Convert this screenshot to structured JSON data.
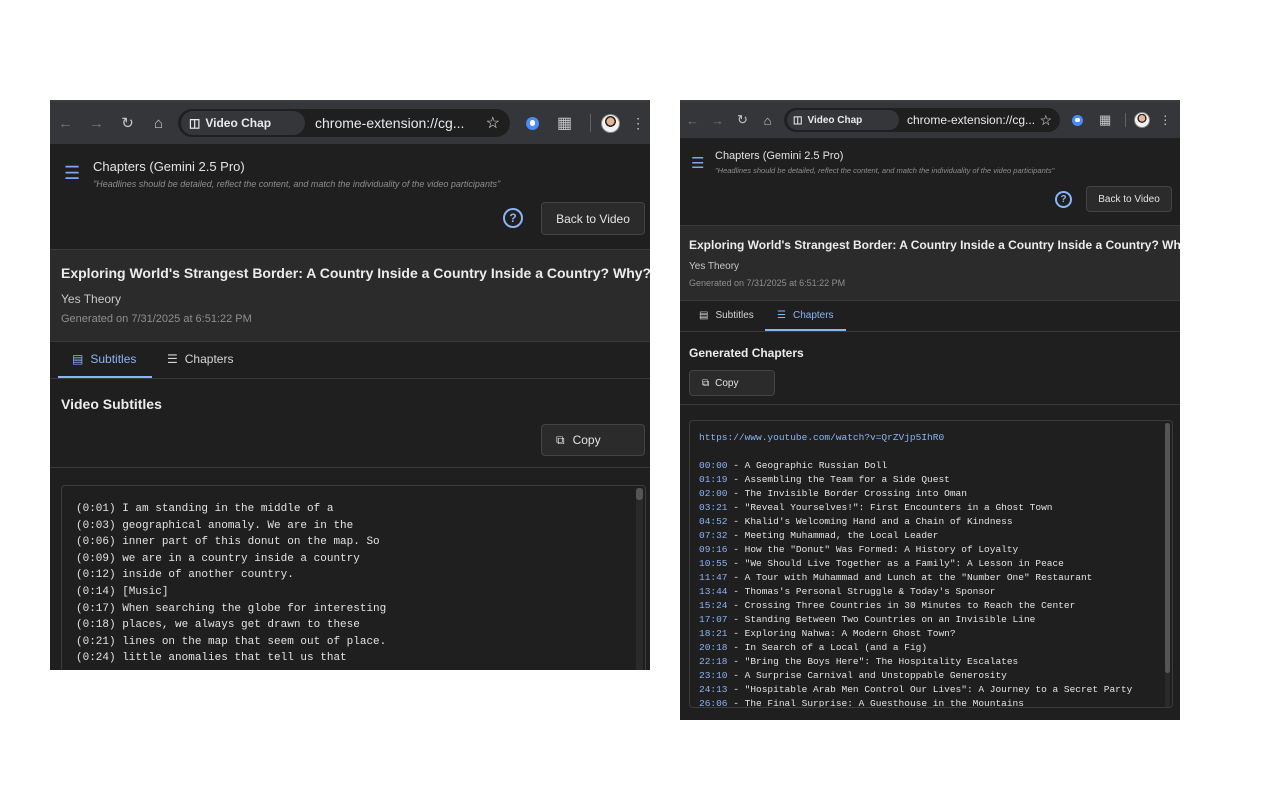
{
  "browser": {
    "site_chip": "Video Chap",
    "url": "chrome-extension://cg...",
    "icons": {
      "back": "arrow-left-icon",
      "forward": "arrow-right-icon",
      "reload": "reload-icon",
      "home": "home-icon",
      "site": "extension-page-icon",
      "star": "star-icon",
      "extension": "extension-active-icon",
      "extensions_menu": "puzzle-icon",
      "profile": "avatar",
      "menu": "kebab-menu-icon"
    }
  },
  "header": {
    "title": "Chapters (Gemini 2.5 Pro)",
    "quote": "\"Headlines should be detailed, reflect the content, and match the individuality of the video participants\"",
    "help": "?",
    "back_button": "Back to Video"
  },
  "video": {
    "title": "Exploring World's Strangest Border: A Country Inside a Country Inside a Country? Why?",
    "channel": "Yes Theory",
    "generated": "Generated on 7/31/2025 at 6:51:22 PM"
  },
  "tabs": [
    {
      "label": "Subtitles",
      "icon": "subtitles-icon"
    },
    {
      "label": "Chapters",
      "icon": "list-icon"
    }
  ],
  "subtitles_view": {
    "active_tab": "Subtitles",
    "section_title": "Video Subtitles",
    "copy_button": "Copy",
    "lines": [
      "(0:01) I am standing in the middle of a",
      "(0:03) geographical anomaly. We are in the",
      "(0:06) inner part of this donut on the map. So",
      "(0:09) we are in a country inside a country",
      "(0:12) inside of another country.",
      "(0:14) [Music]",
      "(0:17) When searching the globe for interesting",
      "(0:18) places, we always get drawn to these",
      "(0:21) lines on the map that seem out of place.",
      "(0:24) little anomalies that tell us that"
    ]
  },
  "chapters_view": {
    "active_tab": "Chapters",
    "section_title": "Generated Chapters",
    "copy_button": "Copy",
    "link": "https://www.youtube.com/watch?v=QrZVjp5IhR0",
    "chapters": [
      {
        "time": "00:00",
        "title": " - A Geographic Russian Doll"
      },
      {
        "time": "01:19",
        "title": " - Assembling the Team for a Side Quest"
      },
      {
        "time": "02:00",
        "title": " - The Invisible Border Crossing into Oman"
      },
      {
        "time": "03:21",
        "title": " - \"Reveal Yourselves!\": First Encounters in a Ghost Town"
      },
      {
        "time": "04:52",
        "title": " - Khalid's Welcoming Hand and a Chain of Kindness"
      },
      {
        "time": "07:32",
        "title": " - Meeting Muhammad, the Local Leader"
      },
      {
        "time": "09:16",
        "title": " - How the \"Donut\" Was Formed: A History of Loyalty"
      },
      {
        "time": "10:55",
        "title": " - \"We Should Live Together as a Family\": A Lesson in Peace"
      },
      {
        "time": "11:47",
        "title": " - A Tour with Muhammad and Lunch at the \"Number One\" Restaurant"
      },
      {
        "time": "13:44",
        "title": " - Thomas's Personal Struggle & Today's Sponsor"
      },
      {
        "time": "15:24",
        "title": " - Crossing Three Countries in 30 Minutes to Reach the Center"
      },
      {
        "time": "17:07",
        "title": " - Standing Between Two Countries on an Invisible Line"
      },
      {
        "time": "18:21",
        "title": " - Exploring Nahwa: A Modern Ghost Town?"
      },
      {
        "time": "20:18",
        "title": " - In Search of a Local (and a Fig)"
      },
      {
        "time": "22:18",
        "title": " - \"Bring the Boys Here\": The Hospitality Escalates"
      },
      {
        "time": "23:10",
        "title": " - A Surprise Carnival and Unstoppable Generosity"
      },
      {
        "time": "24:13",
        "title": " - \"Hospitable Arab Men Control Our Lives\": A Journey to a Secret Party"
      },
      {
        "time": "26:06",
        "title": " - The Final Surprise: A Guesthouse in the Mountains"
      }
    ]
  },
  "colors": {
    "accent": "#8ab4f8",
    "background": "#1f1f1f",
    "panel": "#2b2b2b"
  }
}
